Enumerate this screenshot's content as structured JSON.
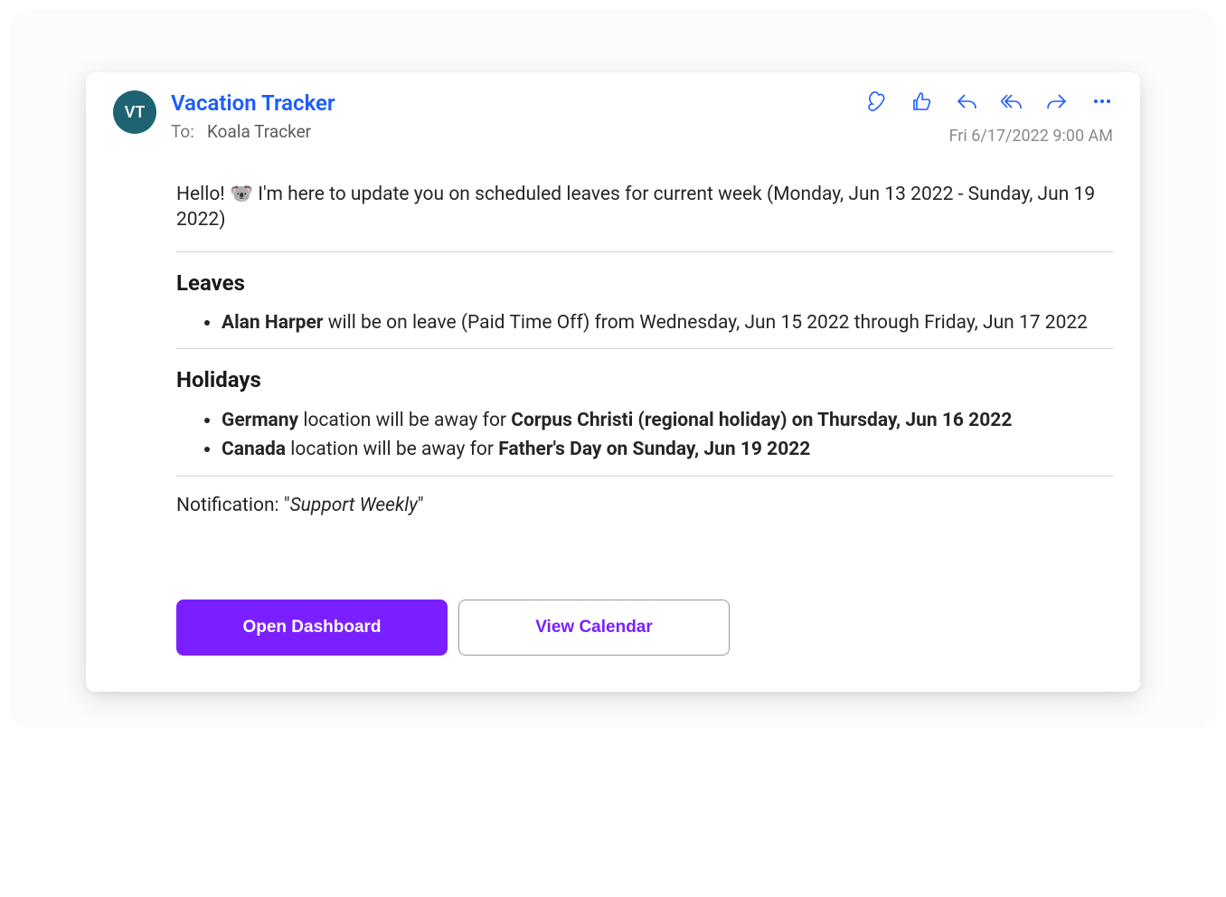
{
  "avatar_initials": "VT",
  "sender": "Vacation Tracker",
  "to_label": "To:",
  "to_recipient": "Koala Tracker",
  "timestamp": "Fri 6/17/2022 9:00 AM",
  "greeting_prefix": "Hello! ",
  "greeting_emoji": "🐨",
  "greeting_text": " I'm here to update you on scheduled leaves for current week (Monday, Jun 13 2022 - Sunday, Jun 19 2022)",
  "sections": {
    "leaves": {
      "title": "Leaves",
      "items": [
        {
          "name": "Alan Harper",
          "rest": " will be on leave (Paid Time Off) from Wednesday, Jun 15 2022 through Friday, Jun 17 2022"
        }
      ]
    },
    "holidays": {
      "title": "Holidays",
      "items": [
        {
          "location": "Germany",
          "mid": " location will be away for ",
          "event": "Corpus Christi (regional holiday) on Thursday, Jun 16 2022"
        },
        {
          "location": "Canada",
          "mid": " location will be away for ",
          "event": "Father's Day on Sunday, Jun 19 2022"
        }
      ]
    }
  },
  "notification_label": "Notification: \"",
  "notification_name": "Support Weekly",
  "notification_close": "\"",
  "buttons": {
    "primary": "Open Dashboard",
    "secondary": "View Calendar"
  },
  "colors": {
    "accent_blue": "#1a5cff",
    "avatar_bg": "#1e6373",
    "brand_purple": "#7a1fff"
  }
}
